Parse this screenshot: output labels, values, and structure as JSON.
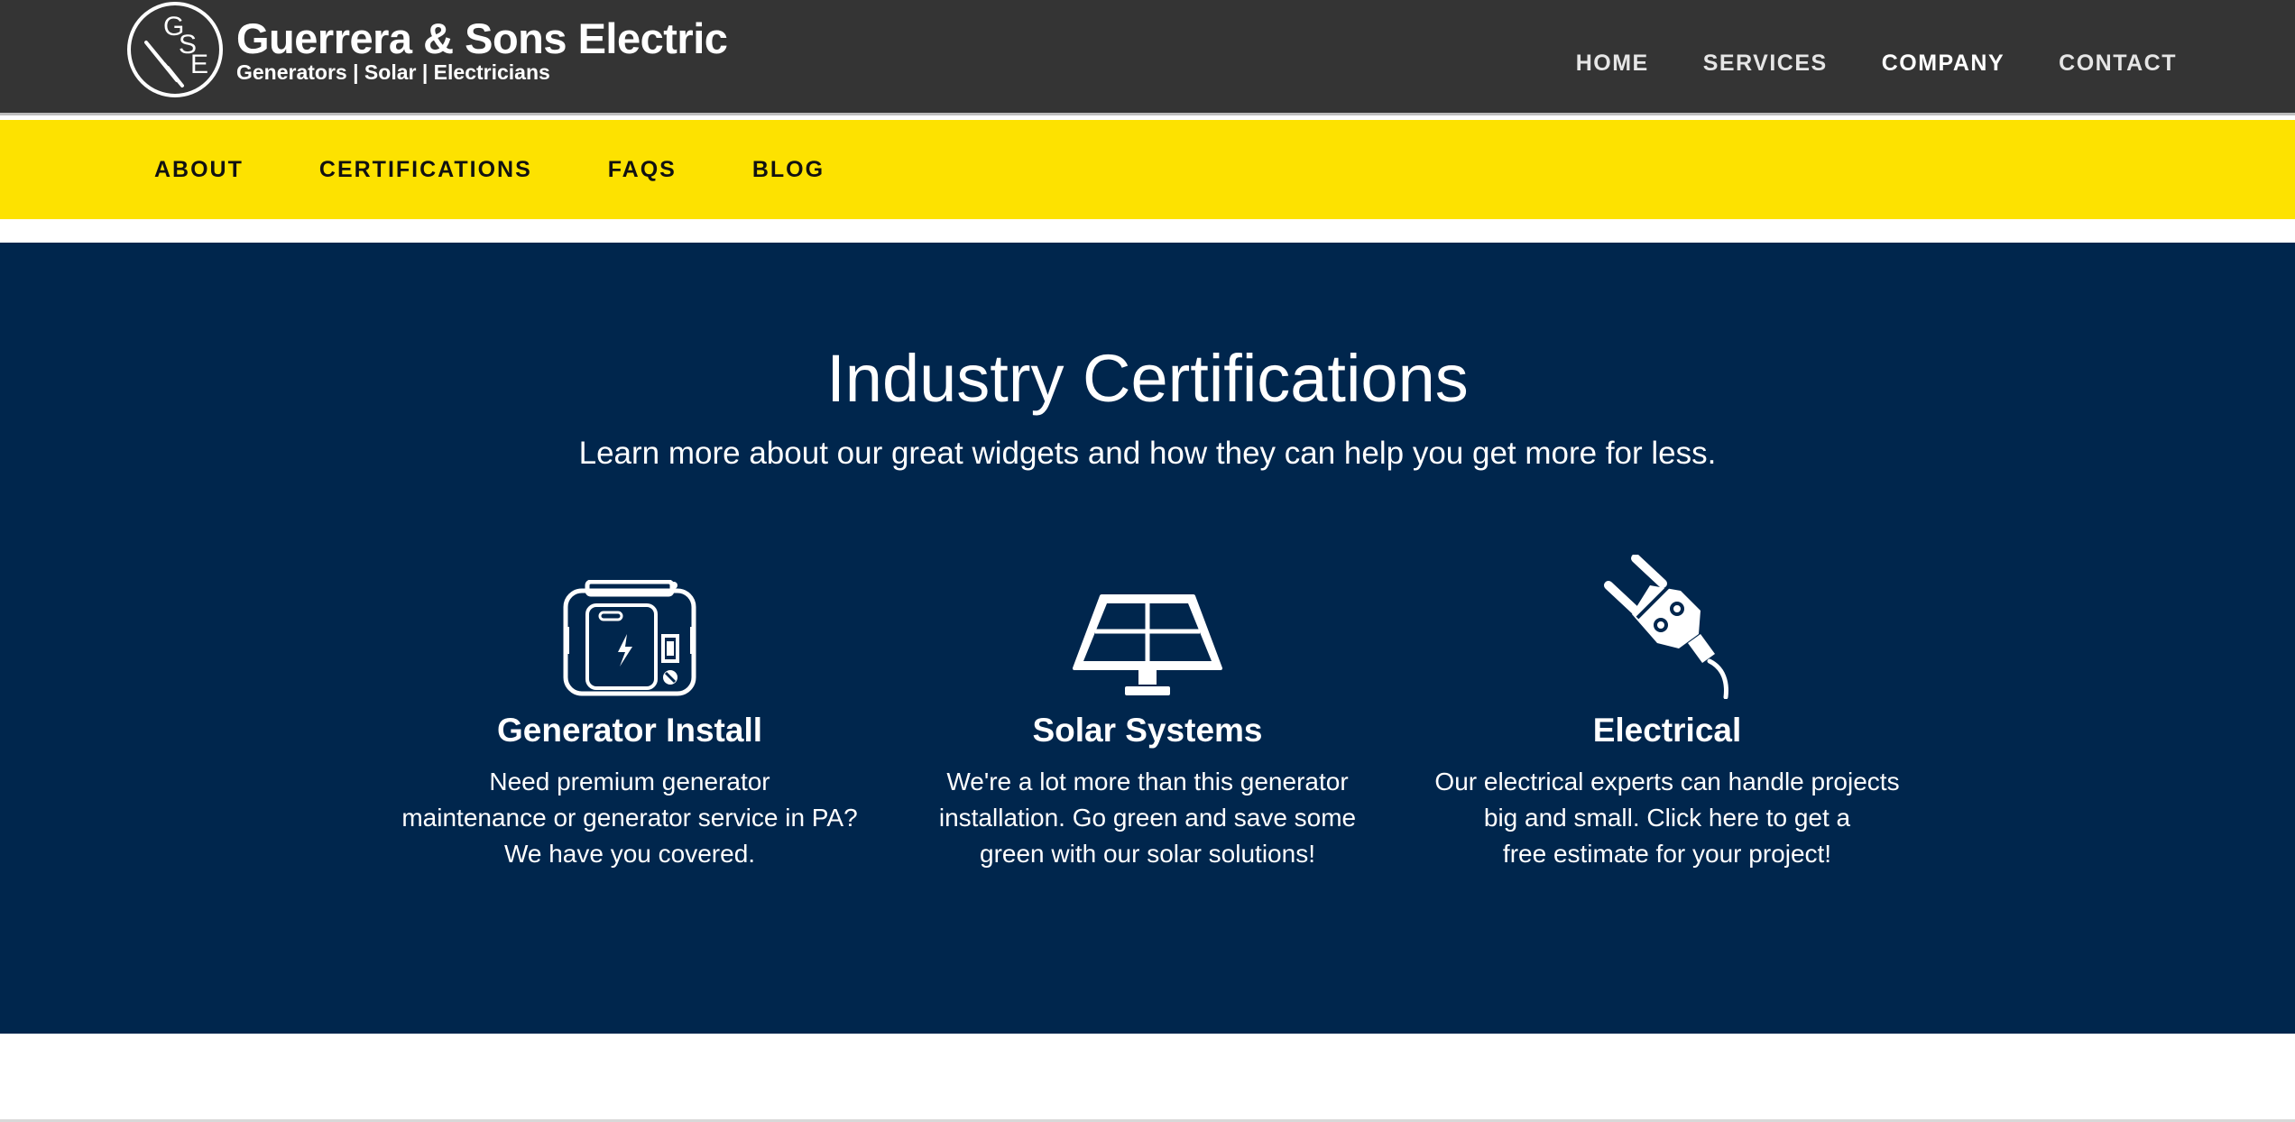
{
  "brand": {
    "badge_letters": [
      "G",
      "S",
      "E"
    ],
    "name": "Guerrera & Sons Electric",
    "tagline": "Generators | Solar | Electricians"
  },
  "main_nav": {
    "items": [
      {
        "label": "HOME",
        "active": false
      },
      {
        "label": "SERVICES",
        "active": false
      },
      {
        "label": "COMPANY",
        "active": true
      },
      {
        "label": "CONTACT",
        "active": false
      }
    ]
  },
  "sub_nav": {
    "items": [
      {
        "label": "ABOUT"
      },
      {
        "label": "CERTIFICATIONS"
      },
      {
        "label": "FAQS"
      },
      {
        "label": "BLOG"
      }
    ]
  },
  "hero": {
    "title": "Industry Certifications",
    "subtitle": "Learn more about our great widgets and how they can help you get more for less."
  },
  "features": [
    {
      "icon": "generator-icon",
      "title": "Generator Install",
      "lines": [
        "Need premium generator",
        "maintenance or generator service in PA?",
        "We have you covered."
      ]
    },
    {
      "icon": "solar-panel-icon",
      "title": "Solar Systems",
      "lines": [
        "We're a lot more than this generator",
        "installation. Go green and save some",
        "green with our solar solutions!"
      ]
    },
    {
      "icon": "electric-plug-icon",
      "title": "Electrical",
      "lines": [
        "Our electrical experts can handle projects",
        "big and small. Click here to get a",
        "free estimate for your project!"
      ]
    }
  ],
  "colors": {
    "header_bg": "#343434",
    "subnav_bg": "#fde200",
    "hero_bg": "#00264d",
    "text_light": "#ffffff",
    "text_dark": "#111111"
  }
}
